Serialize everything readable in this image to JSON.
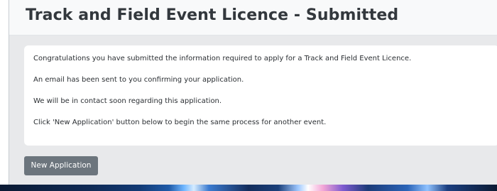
{
  "header": {
    "title": "Track and Field Event Licence - Submitted"
  },
  "message": {
    "lines": [
      "Congratulations you have submitted the information required to apply for a Track and Field Event Licence.",
      "An email has been sent to you confirming your application.",
      "We will be in contact soon regarding this application.",
      "Click 'New Application' button below to begin the same process for another event."
    ]
  },
  "actions": {
    "new_application_label": "New Application"
  },
  "colors": {
    "header_background": "#f8f9fa",
    "content_background": "#e8e9eb",
    "card_background": "#ffffff",
    "button_background": "#6c757d",
    "button_text": "#ffffff",
    "title_text": "#33383d"
  }
}
